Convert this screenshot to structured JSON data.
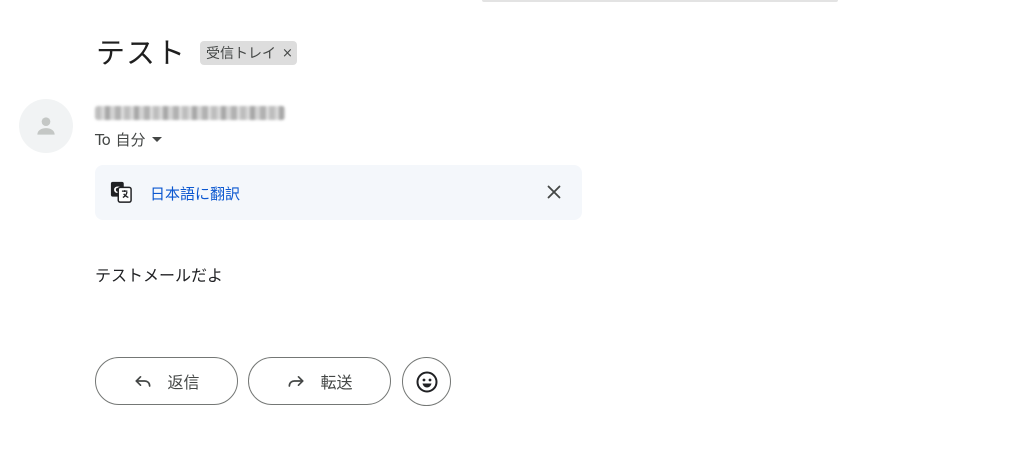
{
  "email": {
    "subject": "テスト",
    "label_chip": {
      "text": "受信トレイ",
      "remove_glyph": "×"
    },
    "to_line": "To 自分",
    "body": "テストメールだよ"
  },
  "translate_bar": {
    "link": "日本語に翻訳",
    "close_glyph": "✕",
    "icon": "translate-icon"
  },
  "actions": {
    "reply_label": "返信",
    "forward_label": "転送",
    "emoji_icon": "emoji-reaction-icon"
  },
  "colors": {
    "link_blue": "#0b57d0",
    "translate_bg": "#f4f7fb",
    "chip_bg": "#dddddd"
  }
}
